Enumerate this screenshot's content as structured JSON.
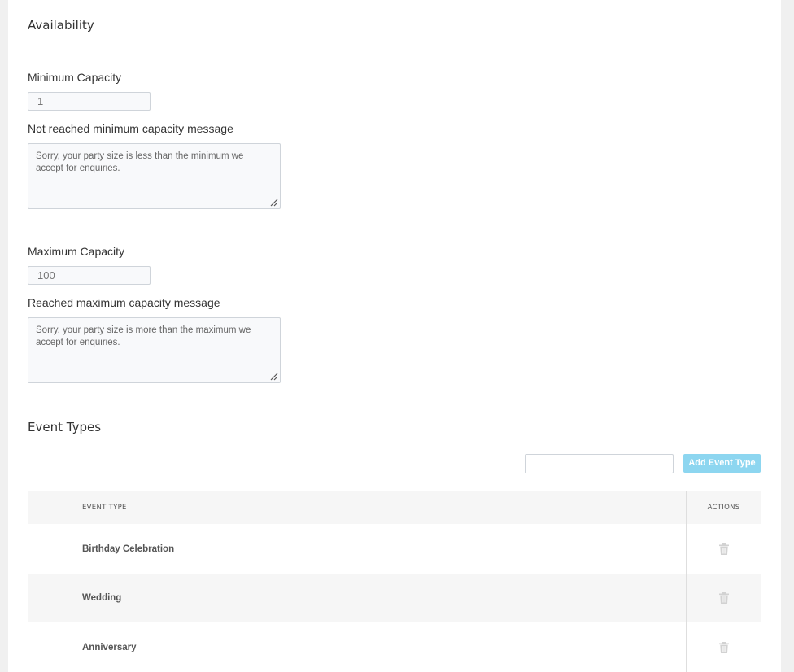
{
  "availability": {
    "title": "Availability",
    "min_capacity_label": "Minimum Capacity",
    "min_capacity_value": "1",
    "min_message_label": "Not reached minimum capacity message",
    "min_message_value": "Sorry, your party size is less than the minimum we accept for enquiries.",
    "max_capacity_label": "Maximum Capacity",
    "max_capacity_value": "100",
    "max_message_label": "Reached maximum capacity message",
    "max_message_value": "Sorry, your party size is more than the maximum we accept for enquiries."
  },
  "event_types": {
    "title": "Event Types",
    "new_type_value": "",
    "add_button_label": "Add Event Type",
    "add_button_color": "#8dd6f0",
    "columns": {
      "type": "EVENT TYPE",
      "actions": "ACTIONS"
    },
    "rows": [
      {
        "name": "Birthday Celebration",
        "action_icon": "trash-icon"
      },
      {
        "name": "Wedding",
        "action_icon": "trash-icon"
      },
      {
        "name": "Anniversary",
        "action_icon": "trash-icon"
      }
    ]
  }
}
